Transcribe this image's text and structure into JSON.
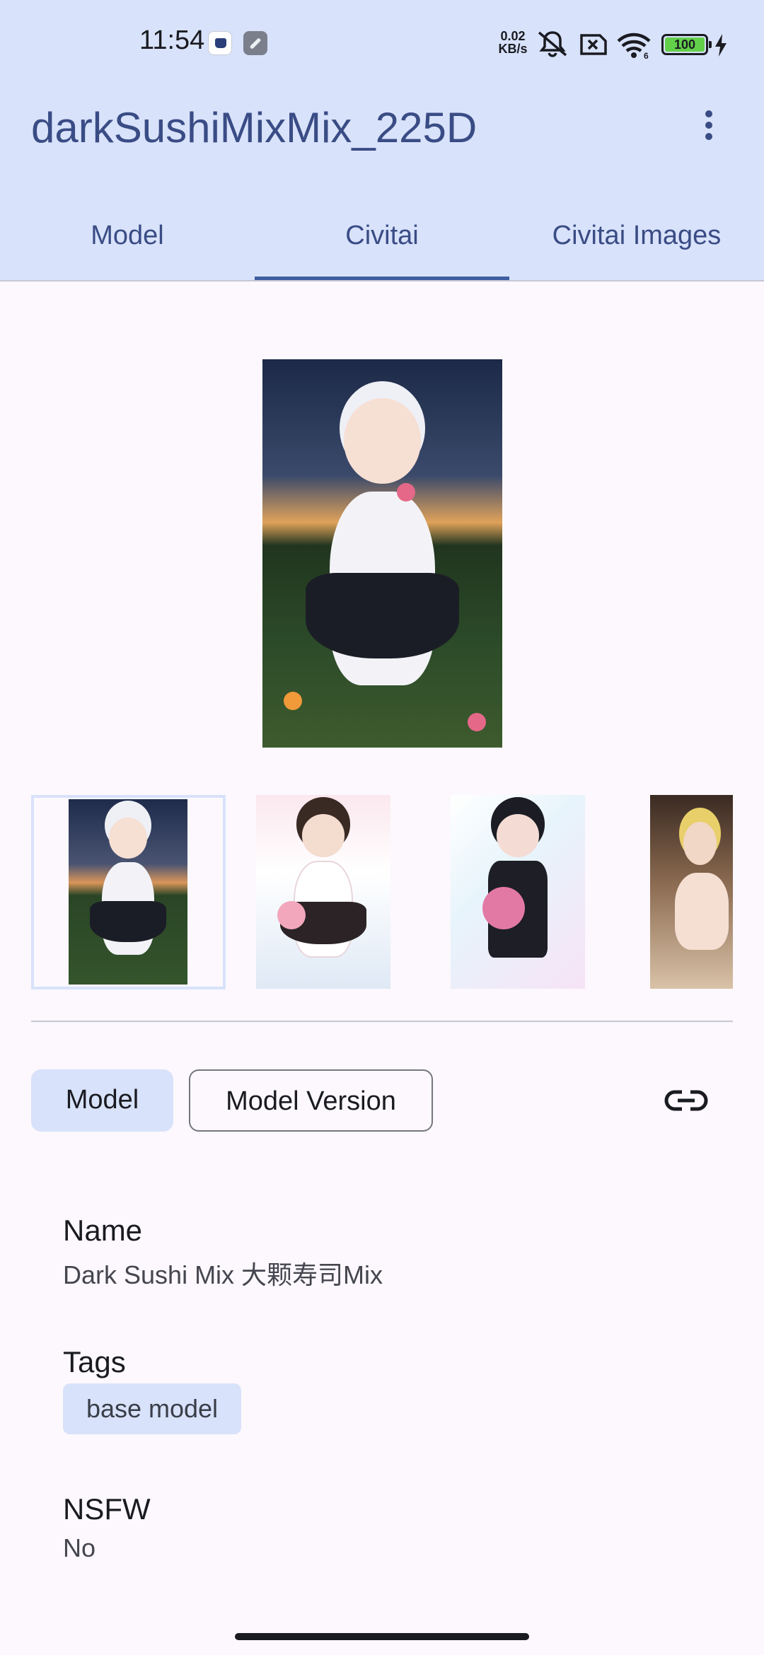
{
  "status_bar": {
    "time": "11:54",
    "net_speed_value": "0.02",
    "net_speed_unit": "KB/s",
    "battery": "100",
    "wifi_label": "6"
  },
  "app_bar": {
    "title": "darkSushiMixMix_225D",
    "tabs": [
      "Model",
      "Civitai",
      "Civitai Images"
    ],
    "active_tab": "Civitai"
  },
  "gallery": {
    "thumbnail_count": 4,
    "selected_index": 0
  },
  "segmented": {
    "model_label": "Model",
    "version_label": "Model Version"
  },
  "details": {
    "name_label": "Name",
    "name_value": "Dark Sushi Mix 大颗寿司Mix",
    "tags_label": "Tags",
    "tags": [
      "base model"
    ],
    "nsfw_label": "NSFW",
    "nsfw_value": "No"
  },
  "colors": {
    "app_bar_bg": "#d8e2fa",
    "primary": "#3a4c85",
    "surface": "#fcf8fd",
    "chip_selected": "#d8e2fa"
  }
}
